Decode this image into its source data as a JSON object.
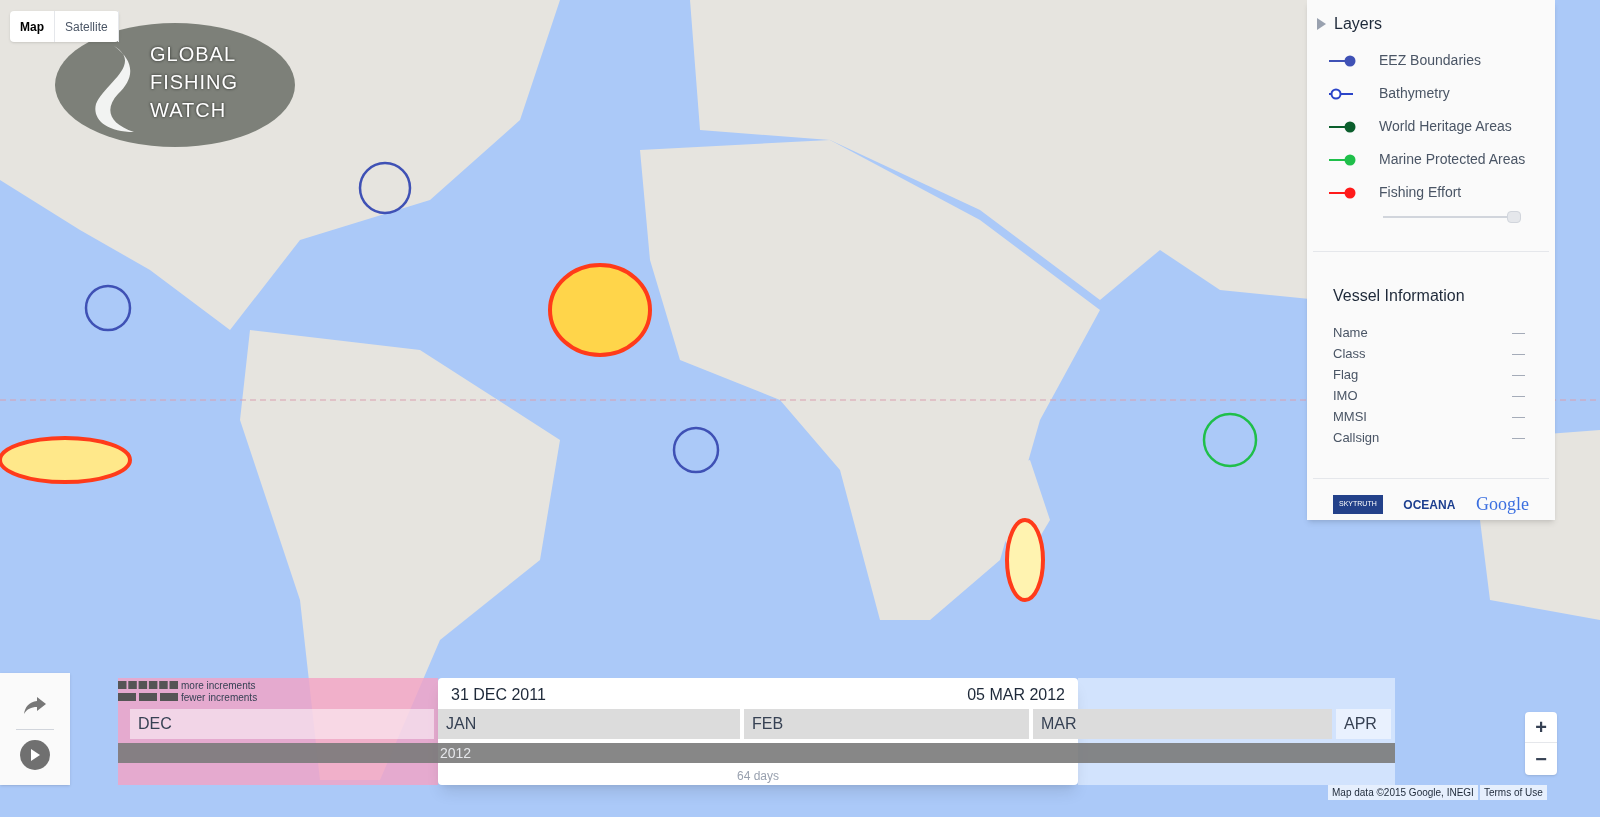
{
  "map_type": [
    {
      "label": "Map",
      "selected": true
    },
    {
      "label": "Satellite",
      "selected": false
    }
  ],
  "logo": {
    "lines": [
      "GLOBAL",
      "FISHING",
      "WATCH"
    ]
  },
  "layers": {
    "title": "Layers",
    "expanded": false,
    "items": [
      {
        "label": "EEZ Boundaries",
        "color": "#3f51b5",
        "on": true
      },
      {
        "label": "Bathymetry",
        "color": "#2a44c8",
        "on": false
      },
      {
        "label": "World Heritage Areas",
        "color": "#0b5e2c",
        "on": true
      },
      {
        "label": "Marine Protected Areas",
        "color": "#1fbf4a",
        "on": true
      },
      {
        "label": "Fishing Effort",
        "color": "#ff1a1a",
        "on": true,
        "level": 0.95
      }
    ]
  },
  "vessel": {
    "title": "Vessel Information",
    "fields": [
      {
        "label": "Name",
        "value": "—"
      },
      {
        "label": "Class",
        "value": "—"
      },
      {
        "label": "Flag",
        "value": "—"
      },
      {
        "label": "IMO",
        "value": "—"
      },
      {
        "label": "MMSI",
        "value": "—"
      },
      {
        "label": "Callsign",
        "value": "—"
      }
    ]
  },
  "partners": [
    "SKYTRUTH",
    "OCEANA",
    "Google"
  ],
  "timeline": {
    "legend": [
      "more increments",
      "fewer increments"
    ],
    "start": "31 DEC 2011",
    "end": "05 MAR 2012",
    "months": [
      {
        "label": "DEC",
        "selected": false
      },
      {
        "label": "JAN",
        "selected": true
      },
      {
        "label": "FEB",
        "selected": true
      },
      {
        "label": "MAR",
        "selected": true
      },
      {
        "label": "APR",
        "selected": false
      }
    ],
    "year": "2012",
    "duration": "64 days"
  },
  "zoom": [
    "+",
    "−"
  ],
  "footer": {
    "attribution": "Map data ©2015 Google, INEGI",
    "terms": "Terms of Use"
  }
}
